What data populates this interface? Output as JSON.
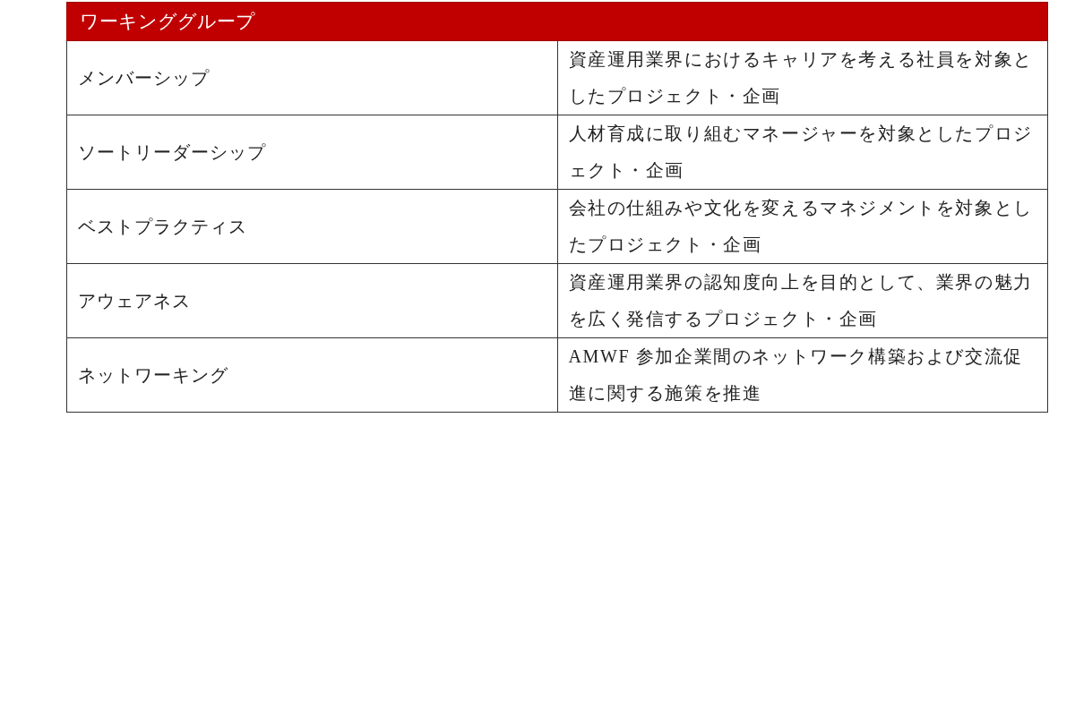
{
  "table": {
    "title": "ワーキンググループ",
    "rows": [
      {
        "name": "メンバーシップ",
        "description": "資産運用業界におけるキャリアを考える社員を対象としたプロジェクト・企画"
      },
      {
        "name": "ソートリーダーシップ",
        "description": "人材育成に取り組むマネージャーを対象としたプロジェクト・企画"
      },
      {
        "name": "ベストプラクティス",
        "description": "会社の仕組みや文化を変えるマネジメントを対象としたプロジェクト・企画"
      },
      {
        "name": "アウェアネス",
        "description": "資産運用業界の認知度向上を目的として、業界の魅力を広く発信するプロジェクト・企画"
      },
      {
        "name": "ネットワーキング",
        "description": "AMWF 参加企業間のネットワーク構築および交流促進に関する施策を推進"
      }
    ]
  }
}
